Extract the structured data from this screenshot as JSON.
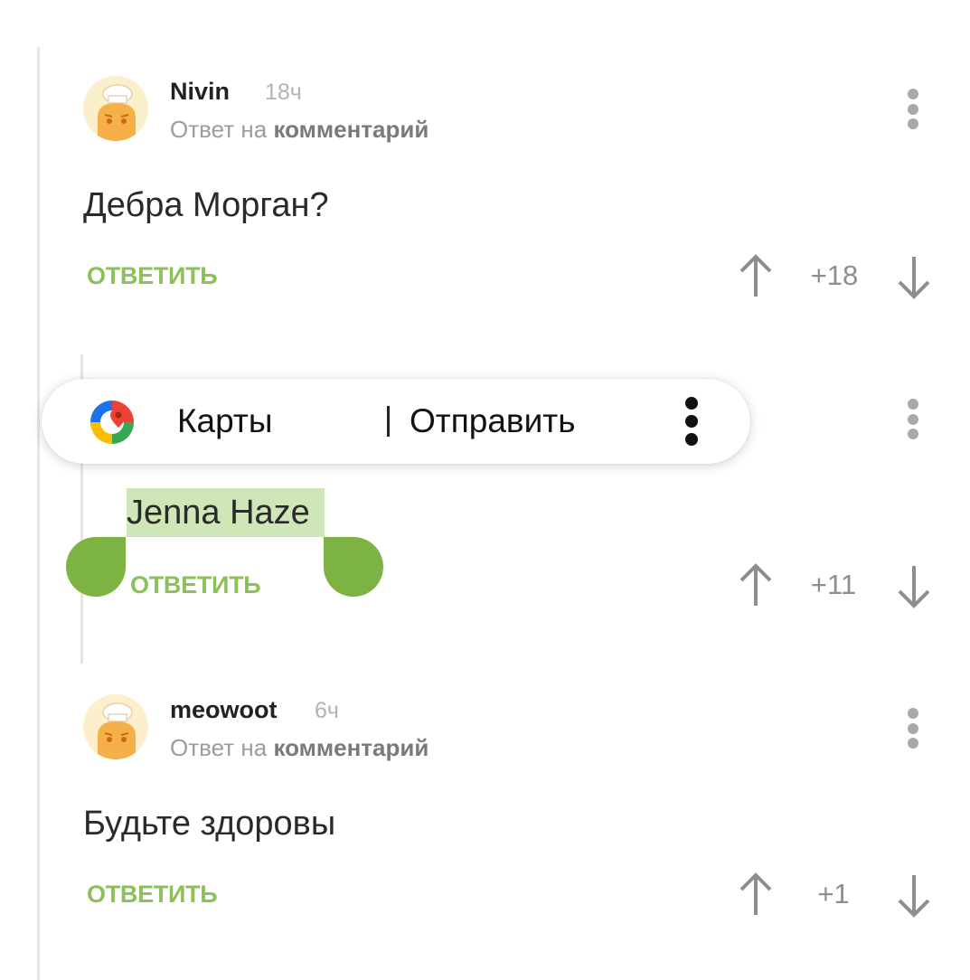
{
  "theme": {
    "accent_green": "#8cc05a",
    "selection_handle": "#7cb342",
    "selection_highlight": "#cfe6b9"
  },
  "comments": [
    {
      "author": "Nivin",
      "time": "18ч",
      "reply_prefix": "Ответ на",
      "reply_target": "комментарий",
      "text": "Дебра Морган?",
      "reply_label": "ОТВЕТИТЬ",
      "score": "+18",
      "avatar_icon": "chef-avatar-icon"
    },
    {
      "text": "Jenna Haze",
      "reply_label": "ОТВЕТИТЬ",
      "score": "+11"
    },
    {
      "author": "meowoot",
      "time": "6ч",
      "reply_prefix": "Ответ на",
      "reply_target": "комментарий",
      "text": "Будьте здоровы",
      "reply_label": "ОТВЕТИТЬ",
      "score": "+1",
      "avatar_icon": "chef-avatar-icon"
    }
  ],
  "selection_toolbar": {
    "maps_label": "Карты",
    "share_label": "Отправить",
    "maps_icon": "google-maps-icon",
    "more_icon": "more-vertical-icon"
  }
}
